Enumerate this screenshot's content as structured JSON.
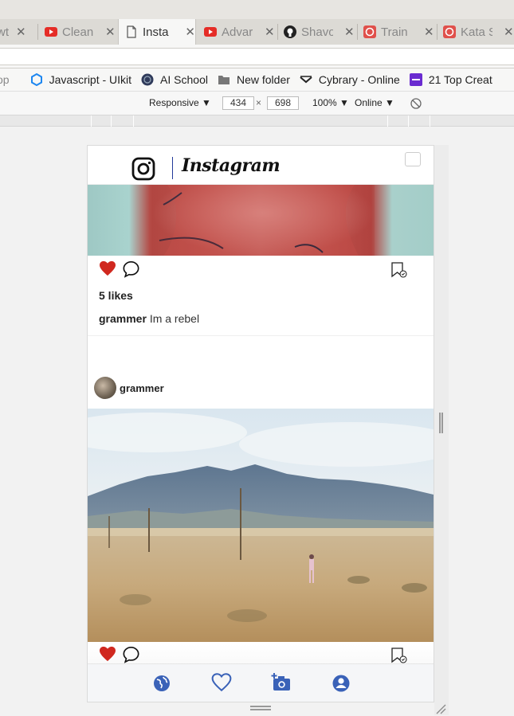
{
  "tabs": [
    {
      "label": "wt",
      "icon": "page-icon",
      "active": false
    },
    {
      "label": "Clean",
      "icon": "youtube-icon",
      "active": false
    },
    {
      "label": "Insta",
      "icon": "page-icon",
      "active": true
    },
    {
      "label": "Advar",
      "icon": "youtube-icon",
      "active": false
    },
    {
      "label": "Shavo",
      "icon": "github-icon",
      "active": false
    },
    {
      "label": "Train",
      "icon": "scrimba-icon",
      "active": false
    },
    {
      "label": "Kata S",
      "icon": "scrimba-icon",
      "active": false
    }
  ],
  "bookmarks": [
    {
      "label": "op",
      "icon": "bookmark-icon"
    },
    {
      "label": "Javascript - UIkit",
      "icon": "uikit-icon"
    },
    {
      "label": "AI School",
      "icon": "ai-school-icon"
    },
    {
      "label": "New folder",
      "icon": "folder-icon"
    },
    {
      "label": "Cybrary - Online",
      "icon": "cybrary-icon"
    },
    {
      "label": "21 Top Creat",
      "icon": "colorlib-icon"
    }
  ],
  "device_toolbar": {
    "mode": "Responsive",
    "width": "434",
    "times": "×",
    "height": "698",
    "zoom": "100%",
    "network": "Online"
  },
  "instagram": {
    "wordmark": "Instagram",
    "post1": {
      "likes": "5 likes",
      "username": "grammer",
      "caption": "Im a rebel"
    },
    "post2": {
      "username": "grammer"
    }
  },
  "colors": {
    "heart_red": "#d0281f",
    "nav_blue": "#3a62b8",
    "wordmark_divider": "#223a9a"
  }
}
